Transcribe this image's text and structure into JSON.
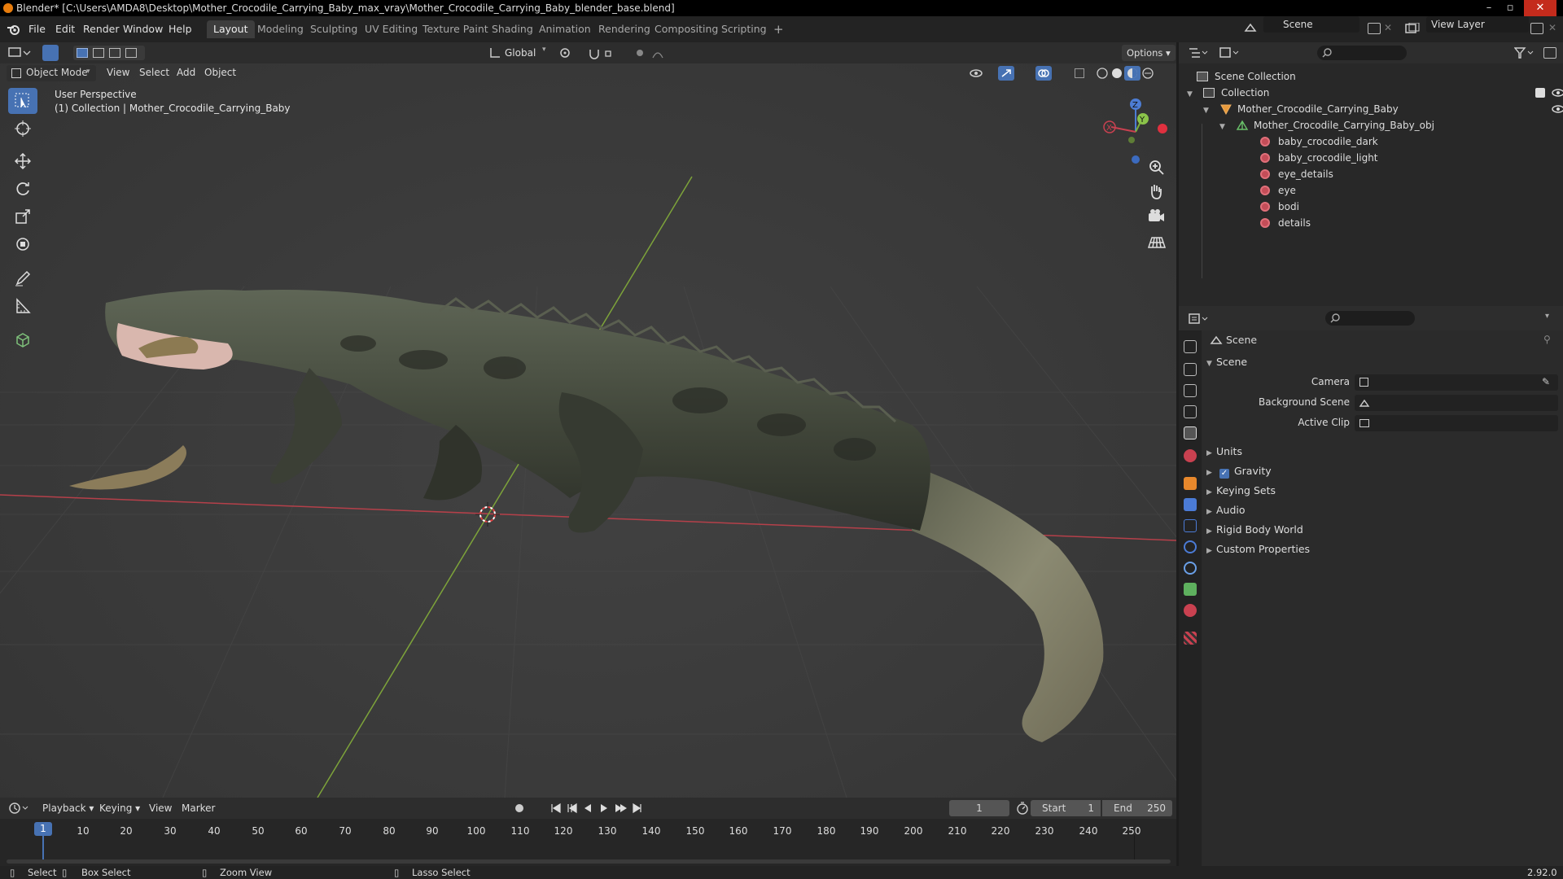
{
  "window": {
    "title": "Blender* [C:\\Users\\AMDA8\\Desktop\\Mother_Crocodile_Carrying_Baby_max_vray\\Mother_Crocodile_Carrying_Baby_blender_base.blend]",
    "minimize": "–",
    "maximize": "▫",
    "close": "✕"
  },
  "menubar": {
    "items": [
      "File",
      "Edit",
      "Render",
      "Window",
      "Help"
    ],
    "workspaces": [
      "Layout",
      "Modeling",
      "Sculpting",
      "UV Editing",
      "Texture Paint",
      "Shading",
      "Animation",
      "Rendering",
      "Compositing",
      "Scripting"
    ],
    "active_workspace": "Layout",
    "add_tab": "+",
    "scene": "Scene",
    "view_layer": "View Layer"
  },
  "viewport": {
    "mode": "Object Mode",
    "menus": [
      "View",
      "Select",
      "Add",
      "Object"
    ],
    "transform_orientation": "Global",
    "options": "Options",
    "overlay_title": "User Perspective",
    "overlay_subtitle": "(1) Collection | Mother_Crocodile_Carrying_Baby",
    "gizmo": {
      "x": "X",
      "y": "Y",
      "z": "Z"
    }
  },
  "outliner": {
    "root": "Scene Collection",
    "collection": "Collection",
    "object": "Mother_Crocodile_Carrying_Baby",
    "mesh": "Mother_Crocodile_Carrying_Baby_obj",
    "materials": [
      "baby_crocodile_dark",
      "baby_crocodile_light",
      "eye_details",
      "eye",
      "bodi",
      "details"
    ]
  },
  "properties": {
    "breadcrumb": "Scene",
    "panel_scene": "Scene",
    "fields": [
      {
        "label": "Camera"
      },
      {
        "label": "Background Scene"
      },
      {
        "label": "Active Clip"
      }
    ],
    "panels": [
      "Units",
      "Gravity",
      "Keying Sets",
      "Audio",
      "Rigid Body World",
      "Custom Properties"
    ],
    "gravity_checked": true
  },
  "timeline": {
    "menus": [
      "Playback",
      "Keying",
      "View",
      "Marker"
    ],
    "current_frame": "1",
    "start_label": "Start",
    "start": "1",
    "end_label": "End",
    "end": "250",
    "ruler": [
      "10",
      "20",
      "30",
      "40",
      "50",
      "60",
      "70",
      "80",
      "90",
      "100",
      "110",
      "120",
      "130",
      "140",
      "150",
      "160",
      "170",
      "180",
      "190",
      "200",
      "210",
      "220",
      "230",
      "240",
      "250"
    ],
    "playhead": "1"
  },
  "statusbar": {
    "select": "Select",
    "box_select": "Box Select",
    "zoom_view": "Zoom View",
    "lasso_select": "Lasso Select",
    "version": "2.92.0"
  }
}
